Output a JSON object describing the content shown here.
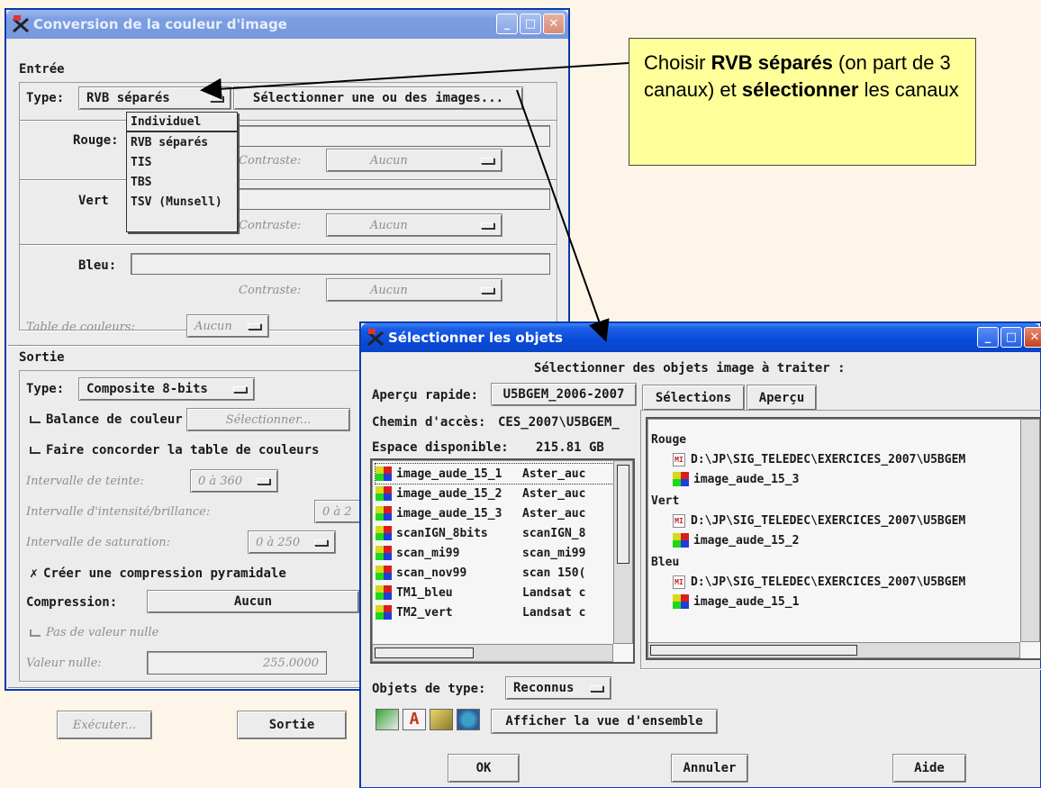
{
  "win1": {
    "title": "Conversion de la couleur d'image",
    "entree_heading": "Entrée",
    "type_label": "Type:",
    "type_value": "RVB séparés",
    "select_images_button": "Sélectionner une ou des images...",
    "rouge_label": "Rouge:",
    "vert_label": "Vert",
    "bleu_label": "Bleu:",
    "contraste_label": "Contraste:",
    "contraste_value": "Aucun",
    "table_couleurs_label": "Table de couleurs:",
    "table_couleurs_value": "Aucun",
    "sortie_heading": "Sortie",
    "sortie_type_label": "Type:",
    "sortie_type_value": "Composite 8-bits",
    "balance_label": "Balance de couleur",
    "balance_button": "Sélectionner...",
    "concorder_label": "Faire concorder la table de couleurs",
    "teinte_label": "Intervalle de teinte:",
    "teinte_value": "0 à 360",
    "intensite_label": "Intervalle d'intensité/brillance:",
    "intensite_value": "0 à 2",
    "saturation_label": "Intervalle de saturation:",
    "saturation_value": "0 à 250",
    "pyramide_check": "✗",
    "pyramide_label": "Créer une compression pyramidale",
    "compression_label": "Compression:",
    "compression_value": "Aucun",
    "pas_valeur_nulle_label": "Pas de valeur nulle",
    "valeur_nulle_label": "Valeur nulle:",
    "valeur_nulle_value": "255.0000",
    "executer_button": "Exécuter...",
    "sortie_button": "Sortie"
  },
  "type_menu": {
    "items": [
      "Individuel",
      "RVB séparés",
      "TIS",
      "TBS",
      "TSV (Munsell)"
    ]
  },
  "callout": {
    "part1": "Choisir ",
    "bold1": "RVB séparés",
    "part2": " (on part de 3 canaux) et ",
    "bold2": "sélectionner",
    "part3": " les canaux"
  },
  "win2": {
    "title": "Sélectionner les objets",
    "heading": "Sélectionner des objets image à traiter :",
    "apercu_rapide_label": "Aperçu rapide:",
    "apercu_rapide_value": "U5BGEM_2006-2007",
    "chemin_label": "Chemin d'accès:",
    "chemin_value": "CES_2007\\U5BGEM_",
    "espace_label": "Espace disponible:",
    "espace_value": "215.81 GB",
    "tab_selections": "Sélections",
    "tab_apercu": "Aperçu",
    "objects": [
      {
        "name": "image_aude_15_1",
        "desc": "Aster_auc"
      },
      {
        "name": "image_aude_15_2",
        "desc": "Aster_auc"
      },
      {
        "name": "image_aude_15_3",
        "desc": "Aster_auc"
      },
      {
        "name": "scanIGN_8bits",
        "desc": "scanIGN_8"
      },
      {
        "name": "scan_mi99",
        "desc": "scan_mi99"
      },
      {
        "name": "scan_nov99",
        "desc": "scan 150("
      },
      {
        "name": "TM1_bleu",
        "desc": "Landsat c"
      },
      {
        "name": "TM2_vert",
        "desc": "Landsat c"
      }
    ],
    "selections": [
      {
        "group": "Rouge",
        "path": "D:\\JP\\SIG_TELEDEC\\EXERCICES_2007\\U5BGEM",
        "image": "image_aude_15_3"
      },
      {
        "group": "Vert",
        "path": "D:\\JP\\SIG_TELEDEC\\EXERCICES_2007\\U5BGEM",
        "image": "image_aude_15_2"
      },
      {
        "group": "Bleu",
        "path": "D:\\JP\\SIG_TELEDEC\\EXERCICES_2007\\U5BGEM",
        "image": "image_aude_15_1"
      }
    ],
    "objets_type_label": "Objets de type:",
    "objets_type_value": "Reconnus",
    "afficher_button": "Afficher la vue d'ensemble",
    "ok_button": "OK",
    "annuler_button": "Annuler",
    "aide_button": "Aide"
  },
  "colors": {
    "xp_title_active": "#0a4ad8",
    "xp_title_inactive": "#7c9fe3",
    "callout_bg": "#ffff99"
  }
}
